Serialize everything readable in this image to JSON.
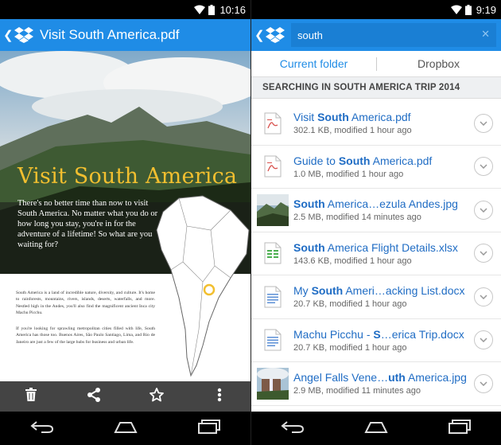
{
  "left": {
    "status_time": "10:16",
    "title": "Visit South America.pdf",
    "pdf": {
      "hero_title": "Visit South America",
      "hero_body": "There's no better time than now to visit South America. No matter what you do or how long you stay, you're in for the adventure of a lifetime! So what are you waiting for?",
      "para1": "South America is a land of incredible nature, diversity, and culture. It's home to rainforests, mountains, rivers, islands, deserts, waterfalls, and more. Nestled high in the Andes, you'll also find the magnificent ancient Inca city Machu Picchu.",
      "para2": "If you're looking for sprawling metropolitan cities filled with life, South America has those too. Buenos Aires, São Paulo Santiago, Lima, and Rio de Janeiro are just a few of the large hubs for business and urban life."
    },
    "actions": [
      "delete-icon",
      "share-icon",
      "star-icon",
      "more-icon"
    ]
  },
  "right": {
    "status_time": "9:19",
    "search_query": "south",
    "tabs": [
      "Current folder",
      "Dropbox"
    ],
    "section_header": "SEARCHING IN SOUTH AMERICA TRIP 2014",
    "results": [
      {
        "pre": "Visit ",
        "match": "South",
        "post": " America.pdf",
        "meta": "302.1 KB, modified 1 hour ago",
        "kind": "pdf"
      },
      {
        "pre": "Guide to ",
        "match": "South",
        "post": " America.pdf",
        "meta": "1.0 MB, modified 1 hour ago",
        "kind": "pdf"
      },
      {
        "pre": "",
        "match": "South",
        "post": " America…ezula Andes.jpg",
        "meta": "2.5 MB, modified 14 minutes ago",
        "kind": "photo-andes"
      },
      {
        "pre": "",
        "match": "South",
        "post": " America Flight Details.xlsx",
        "meta": "143.6 KB, modified 1 hour ago",
        "kind": "xlsx"
      },
      {
        "pre": "My ",
        "match": "South",
        "post": " Ameri…acking List.docx",
        "meta": "20.7 KB, modified 1 hour ago",
        "kind": "docx"
      },
      {
        "pre": "Machu Picchu - ",
        "match": "S",
        "post": "…erica Trip.docx",
        "meta": "20.7 KB, modified 1 hour ago",
        "kind": "docx"
      },
      {
        "pre": "Angel Falls Vene…",
        "match": "uth",
        "post": " America.jpg",
        "meta": "2.9 MB, modified 11 minutes ago",
        "kind": "photo-falls"
      }
    ]
  },
  "colors": {
    "appbar": "#1f8ce6",
    "link": "#1f6cc4",
    "accent_title": "#f2bf2f"
  }
}
